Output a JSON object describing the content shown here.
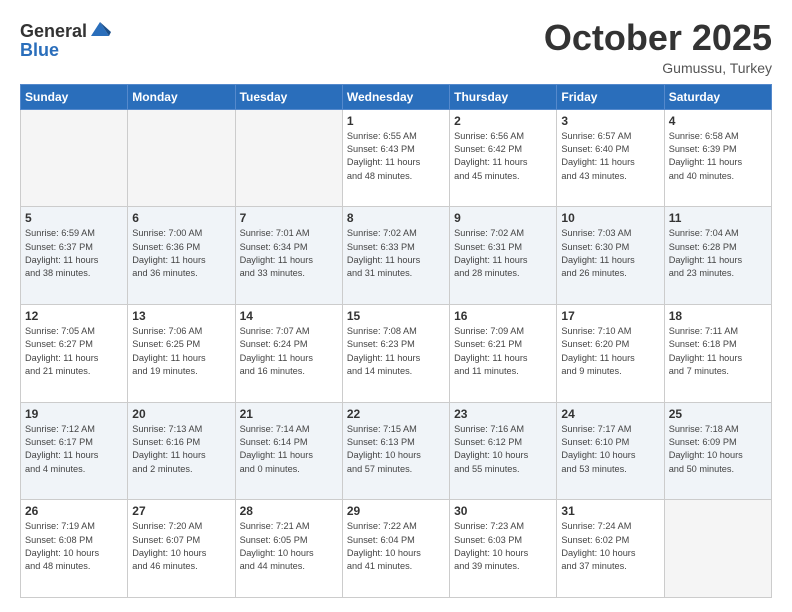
{
  "header": {
    "logo_line1": "General",
    "logo_line2": "Blue",
    "month": "October 2025",
    "location": "Gumussu, Turkey"
  },
  "weekdays": [
    "Sunday",
    "Monday",
    "Tuesday",
    "Wednesday",
    "Thursday",
    "Friday",
    "Saturday"
  ],
  "rows": [
    {
      "shade": "white",
      "days": [
        {
          "num": "",
          "info": ""
        },
        {
          "num": "",
          "info": ""
        },
        {
          "num": "",
          "info": ""
        },
        {
          "num": "1",
          "info": "Sunrise: 6:55 AM\nSunset: 6:43 PM\nDaylight: 11 hours\nand 48 minutes."
        },
        {
          "num": "2",
          "info": "Sunrise: 6:56 AM\nSunset: 6:42 PM\nDaylight: 11 hours\nand 45 minutes."
        },
        {
          "num": "3",
          "info": "Sunrise: 6:57 AM\nSunset: 6:40 PM\nDaylight: 11 hours\nand 43 minutes."
        },
        {
          "num": "4",
          "info": "Sunrise: 6:58 AM\nSunset: 6:39 PM\nDaylight: 11 hours\nand 40 minutes."
        }
      ]
    },
    {
      "shade": "shaded",
      "days": [
        {
          "num": "5",
          "info": "Sunrise: 6:59 AM\nSunset: 6:37 PM\nDaylight: 11 hours\nand 38 minutes."
        },
        {
          "num": "6",
          "info": "Sunrise: 7:00 AM\nSunset: 6:36 PM\nDaylight: 11 hours\nand 36 minutes."
        },
        {
          "num": "7",
          "info": "Sunrise: 7:01 AM\nSunset: 6:34 PM\nDaylight: 11 hours\nand 33 minutes."
        },
        {
          "num": "8",
          "info": "Sunrise: 7:02 AM\nSunset: 6:33 PM\nDaylight: 11 hours\nand 31 minutes."
        },
        {
          "num": "9",
          "info": "Sunrise: 7:02 AM\nSunset: 6:31 PM\nDaylight: 11 hours\nand 28 minutes."
        },
        {
          "num": "10",
          "info": "Sunrise: 7:03 AM\nSunset: 6:30 PM\nDaylight: 11 hours\nand 26 minutes."
        },
        {
          "num": "11",
          "info": "Sunrise: 7:04 AM\nSunset: 6:28 PM\nDaylight: 11 hours\nand 23 minutes."
        }
      ]
    },
    {
      "shade": "white",
      "days": [
        {
          "num": "12",
          "info": "Sunrise: 7:05 AM\nSunset: 6:27 PM\nDaylight: 11 hours\nand 21 minutes."
        },
        {
          "num": "13",
          "info": "Sunrise: 7:06 AM\nSunset: 6:25 PM\nDaylight: 11 hours\nand 19 minutes."
        },
        {
          "num": "14",
          "info": "Sunrise: 7:07 AM\nSunset: 6:24 PM\nDaylight: 11 hours\nand 16 minutes."
        },
        {
          "num": "15",
          "info": "Sunrise: 7:08 AM\nSunset: 6:23 PM\nDaylight: 11 hours\nand 14 minutes."
        },
        {
          "num": "16",
          "info": "Sunrise: 7:09 AM\nSunset: 6:21 PM\nDaylight: 11 hours\nand 11 minutes."
        },
        {
          "num": "17",
          "info": "Sunrise: 7:10 AM\nSunset: 6:20 PM\nDaylight: 11 hours\nand 9 minutes."
        },
        {
          "num": "18",
          "info": "Sunrise: 7:11 AM\nSunset: 6:18 PM\nDaylight: 11 hours\nand 7 minutes."
        }
      ]
    },
    {
      "shade": "shaded",
      "days": [
        {
          "num": "19",
          "info": "Sunrise: 7:12 AM\nSunset: 6:17 PM\nDaylight: 11 hours\nand 4 minutes."
        },
        {
          "num": "20",
          "info": "Sunrise: 7:13 AM\nSunset: 6:16 PM\nDaylight: 11 hours\nand 2 minutes."
        },
        {
          "num": "21",
          "info": "Sunrise: 7:14 AM\nSunset: 6:14 PM\nDaylight: 11 hours\nand 0 minutes."
        },
        {
          "num": "22",
          "info": "Sunrise: 7:15 AM\nSunset: 6:13 PM\nDaylight: 10 hours\nand 57 minutes."
        },
        {
          "num": "23",
          "info": "Sunrise: 7:16 AM\nSunset: 6:12 PM\nDaylight: 10 hours\nand 55 minutes."
        },
        {
          "num": "24",
          "info": "Sunrise: 7:17 AM\nSunset: 6:10 PM\nDaylight: 10 hours\nand 53 minutes."
        },
        {
          "num": "25",
          "info": "Sunrise: 7:18 AM\nSunset: 6:09 PM\nDaylight: 10 hours\nand 50 minutes."
        }
      ]
    },
    {
      "shade": "white",
      "days": [
        {
          "num": "26",
          "info": "Sunrise: 7:19 AM\nSunset: 6:08 PM\nDaylight: 10 hours\nand 48 minutes."
        },
        {
          "num": "27",
          "info": "Sunrise: 7:20 AM\nSunset: 6:07 PM\nDaylight: 10 hours\nand 46 minutes."
        },
        {
          "num": "28",
          "info": "Sunrise: 7:21 AM\nSunset: 6:05 PM\nDaylight: 10 hours\nand 44 minutes."
        },
        {
          "num": "29",
          "info": "Sunrise: 7:22 AM\nSunset: 6:04 PM\nDaylight: 10 hours\nand 41 minutes."
        },
        {
          "num": "30",
          "info": "Sunrise: 7:23 AM\nSunset: 6:03 PM\nDaylight: 10 hours\nand 39 minutes."
        },
        {
          "num": "31",
          "info": "Sunrise: 7:24 AM\nSunset: 6:02 PM\nDaylight: 10 hours\nand 37 minutes."
        },
        {
          "num": "",
          "info": ""
        }
      ]
    }
  ]
}
